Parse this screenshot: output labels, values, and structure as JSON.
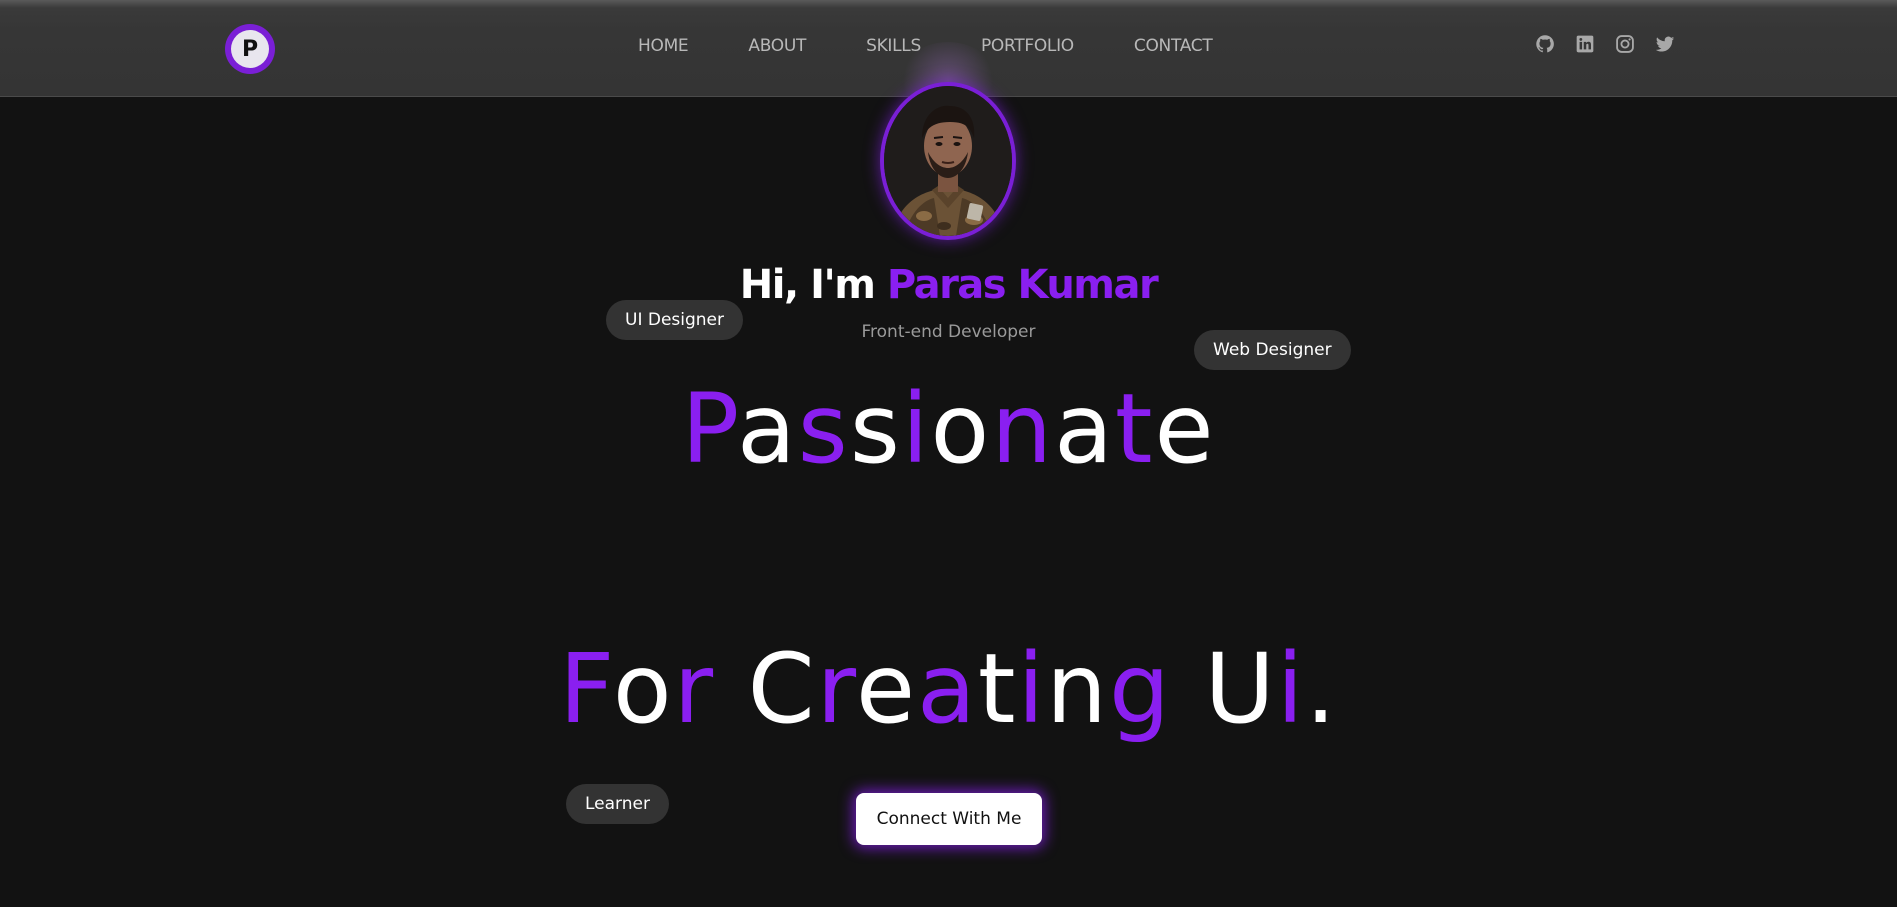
{
  "logo": {
    "letter": "P"
  },
  "nav": {
    "items": [
      {
        "label": "HOME"
      },
      {
        "label": "ABOUT"
      },
      {
        "label": "SKILLS"
      },
      {
        "label": "PORTFOLIO"
      },
      {
        "label": "CONTACT"
      }
    ]
  },
  "socials": [
    {
      "icon": "github-icon"
    },
    {
      "icon": "linkedin-icon"
    },
    {
      "icon": "instagram-icon"
    },
    {
      "icon": "twitter-icon"
    }
  ],
  "hero": {
    "greeting": "Hi, I'm ",
    "name": "Paras Kumar",
    "role": "Front-end Developer",
    "word1": "Passionate",
    "word2": "For Creating Ui.",
    "cta_label": "Connect With Me"
  },
  "tags": {
    "ui_designer": "UI Designer",
    "web_designer": "Web Designer",
    "learner": "Learner"
  },
  "colors": {
    "accent": "#8a1ff0",
    "background": "#121212",
    "navbar": "#363636",
    "pill": "#333333"
  }
}
